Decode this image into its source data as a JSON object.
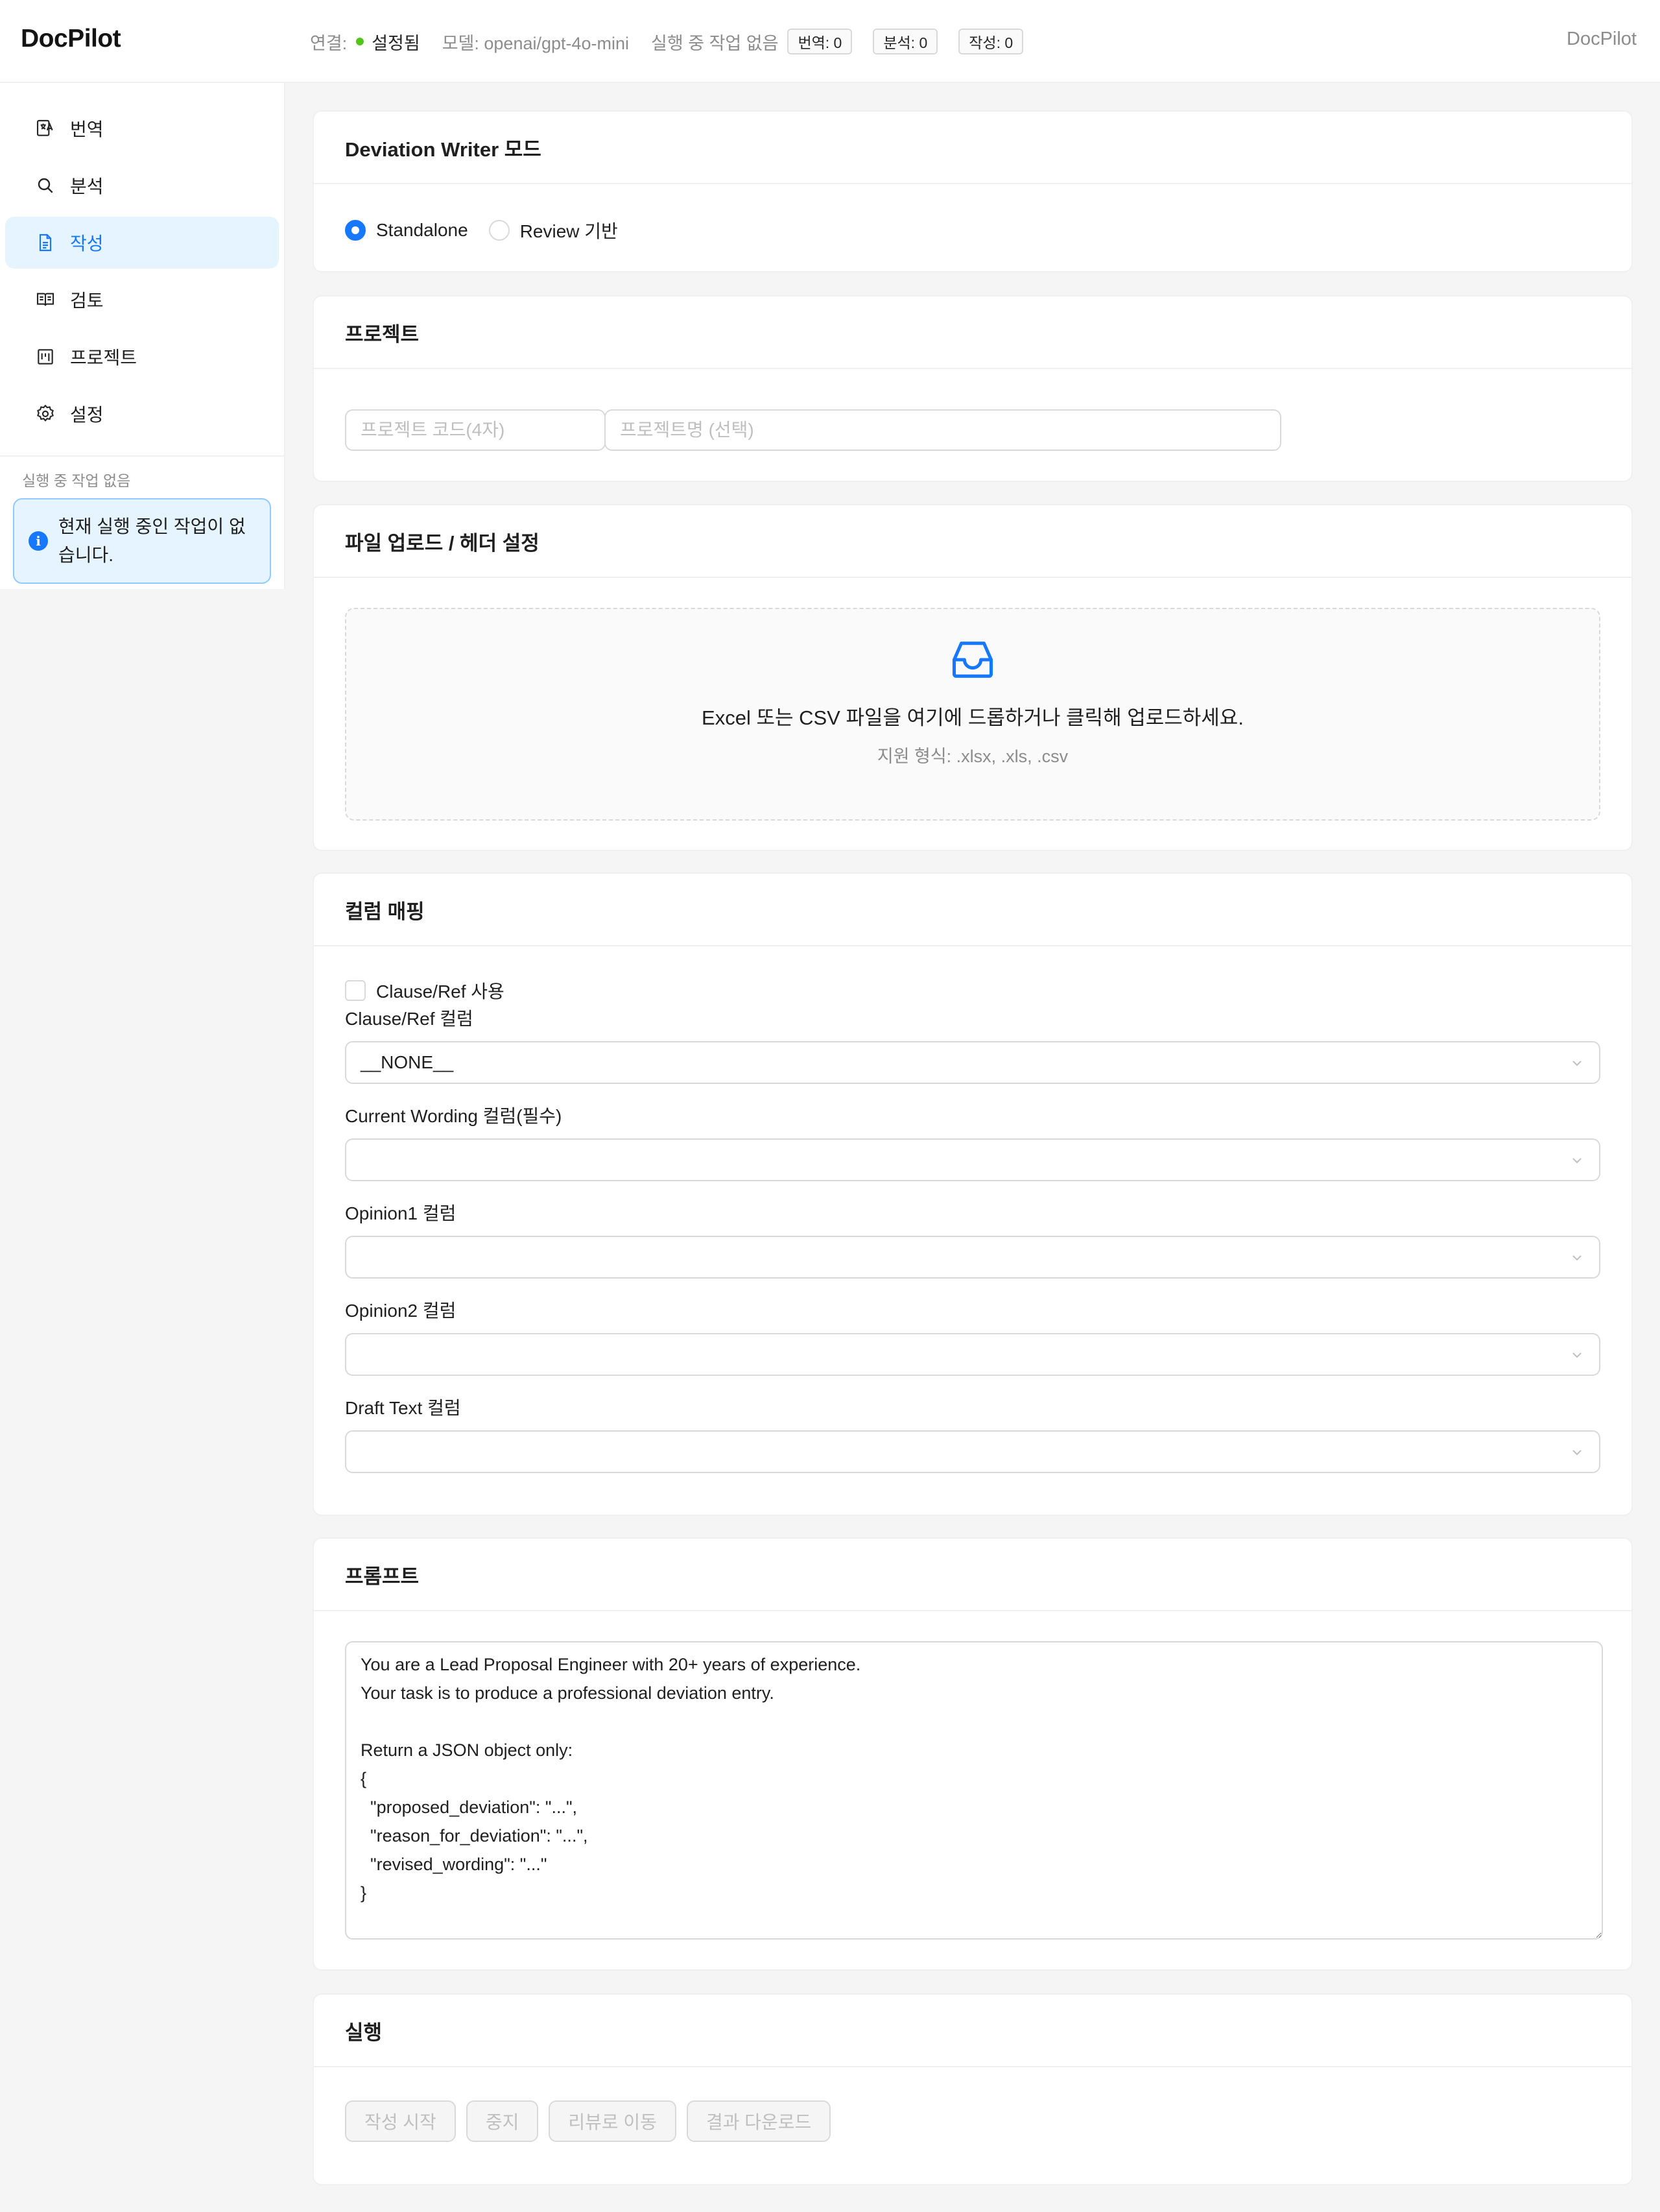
{
  "app": {
    "name": "DocPilot",
    "header_right": "DocPilot"
  },
  "status": {
    "connection_label": "연결:",
    "connection_value": "설정됨",
    "model_label": "모델: openai/gpt-4o-mini",
    "running_label": "실행 중 작업 없음",
    "tags": [
      "번역: 0",
      "분석: 0",
      "작성: 0"
    ],
    "connection_color": "#52c41a"
  },
  "sidebar": {
    "items": [
      {
        "label": "번역",
        "icon": "translate-icon"
      },
      {
        "label": "분석",
        "icon": "search-icon"
      },
      {
        "label": "작성",
        "icon": "file-text-icon",
        "active": true
      },
      {
        "label": "검토",
        "icon": "book-icon"
      },
      {
        "label": "프로젝트",
        "icon": "project-icon"
      },
      {
        "label": "설정",
        "icon": "gear-icon"
      }
    ],
    "caption": "실행 중 작업 없음",
    "alert_text": "현재 실행 중인 작업이 없습니다.",
    "accent": "#1677ff"
  },
  "mode": {
    "title": "Deviation Writer 모드",
    "options": [
      {
        "label": "Standalone",
        "checked": true
      },
      {
        "label": "Review 기반",
        "checked": false
      }
    ]
  },
  "project": {
    "title": "프로젝트",
    "code_placeholder": "프로젝트 코드(4자)",
    "name_placeholder": "프로젝트명 (선택)"
  },
  "upload": {
    "title": "파일 업로드 / 헤더 설정",
    "main_text": "Excel 또는 CSV 파일을 여기에 드롭하거나 클릭해 업로드하세요.",
    "hint": "지원 형식: .xlsx, .xls, .csv"
  },
  "mapping": {
    "title": "컬럼 매핑",
    "use_clause_label": "Clause/Ref 사용",
    "fields": [
      {
        "label": "Clause/Ref 컬럼",
        "value": "__NONE__"
      },
      {
        "label": "Current Wording 컬럼(필수)",
        "value": ""
      },
      {
        "label": "Opinion1 컬럼",
        "value": ""
      },
      {
        "label": "Opinion2 컬럼",
        "value": ""
      },
      {
        "label": "Draft Text 컬럼",
        "value": ""
      }
    ]
  },
  "prompt": {
    "title": "프롬프트",
    "text": "You are a Lead Proposal Engineer with 20+ years of experience.\nYour task is to produce a professional deviation entry.\n\nReturn a JSON object only:\n{\n  \"proposed_deviation\": \"...\",\n  \"reason_for_deviation\": \"...\",\n  \"revised_wording\": \"...\"\n}"
  },
  "run": {
    "title": "실행",
    "buttons": [
      "작성 시작",
      "중지",
      "리뷰로 이동",
      "결과 다운로드"
    ]
  }
}
